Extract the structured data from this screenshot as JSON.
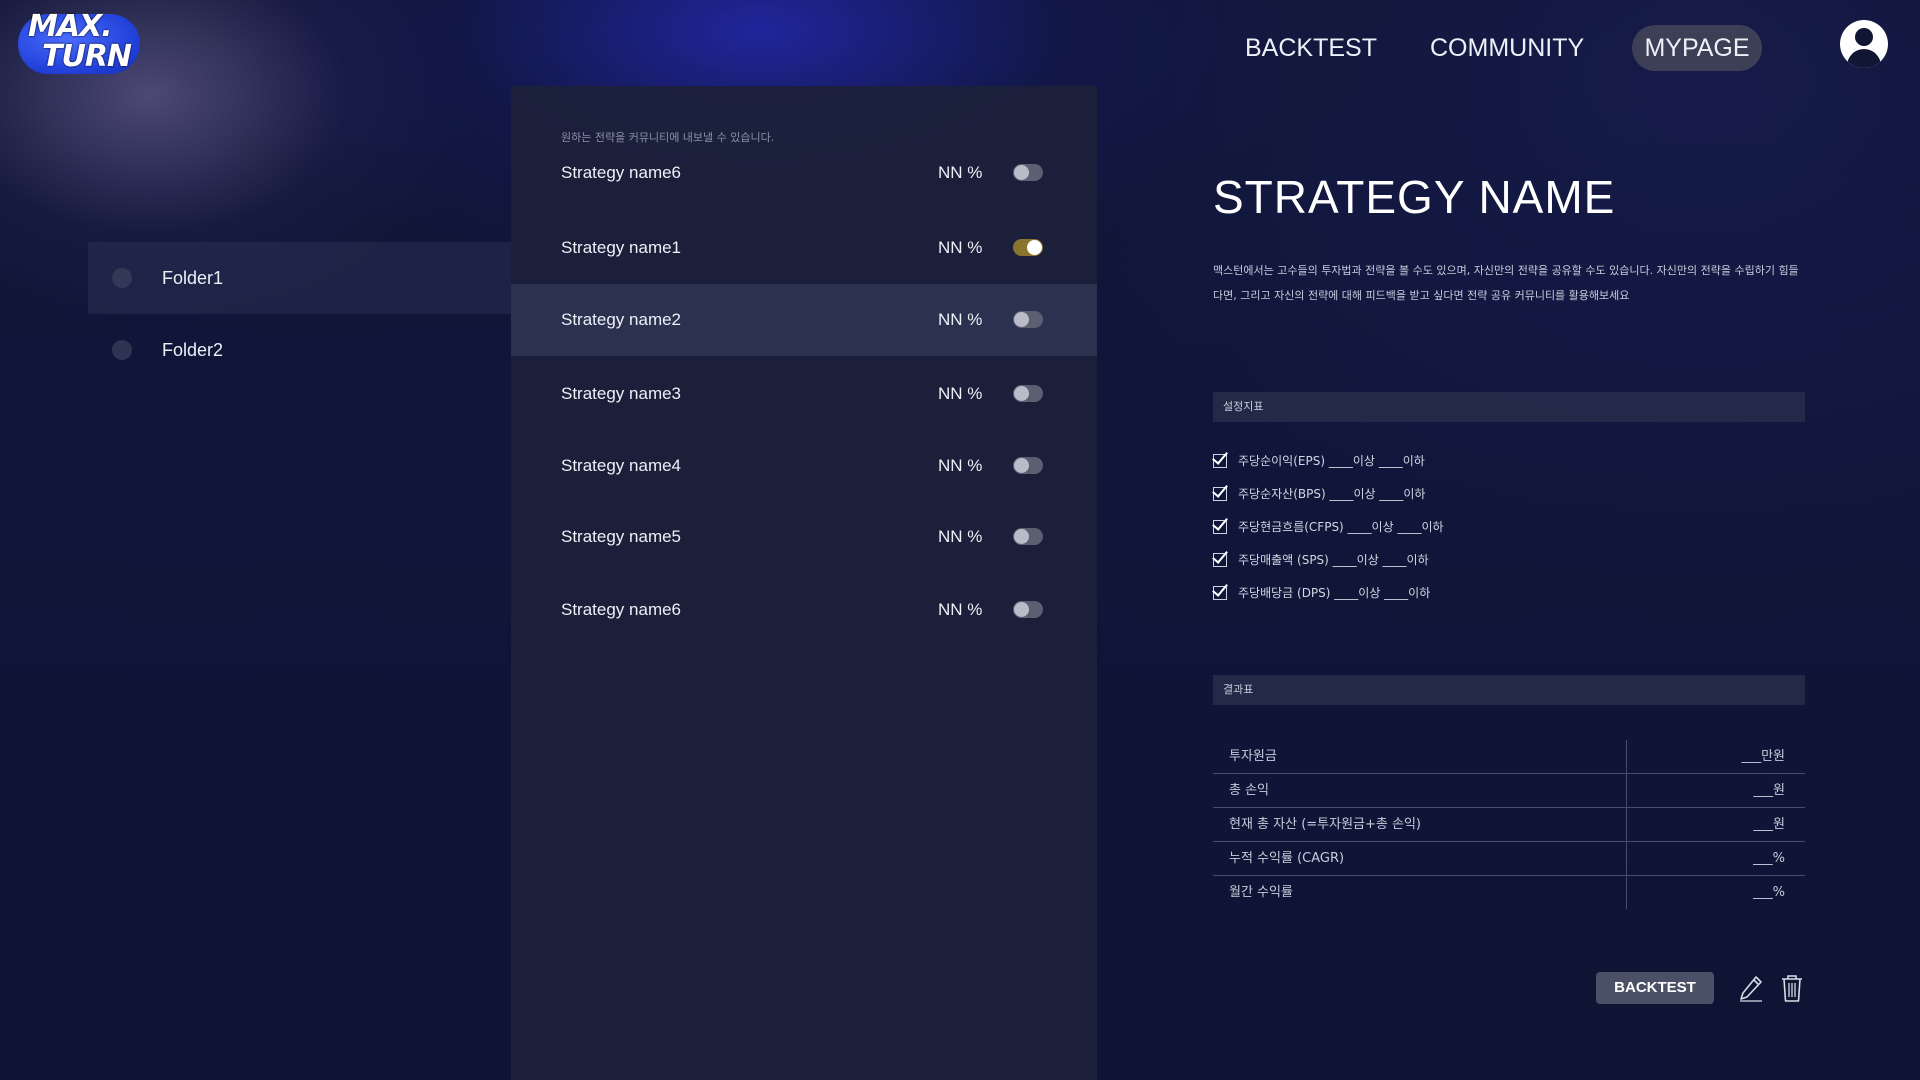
{
  "header": {
    "logo": {
      "line1": "MAX.",
      "line2": "TURN"
    },
    "nav": [
      {
        "label": "BACKTEST"
      },
      {
        "label": "COMMUNITY"
      },
      {
        "label": "MYPAGE",
        "active": true
      }
    ],
    "avatar_icon": "user-avatar-icon"
  },
  "folders": [
    {
      "label": "Folder1",
      "active": true
    },
    {
      "label": "Folder2",
      "active": false
    }
  ],
  "strategy_panel": {
    "hint": "원하는 전략을 커뮤니티에 내보낼 수 있습니다.",
    "items": [
      {
        "name": "Strategy name6",
        "pct": "NN %",
        "toggle_on": false
      },
      {
        "name": "Strategy name1",
        "pct": "NN %",
        "toggle_on": true
      },
      {
        "name": "Strategy name2",
        "pct": "NN %",
        "toggle_on": false,
        "selected": true
      },
      {
        "name": "Strategy name3",
        "pct": "NN %",
        "toggle_on": false
      },
      {
        "name": "Strategy name4",
        "pct": "NN %",
        "toggle_on": false
      },
      {
        "name": "Strategy name5",
        "pct": "NN %",
        "toggle_on": false
      },
      {
        "name": "Strategy name6",
        "pct": "NN %",
        "toggle_on": false
      }
    ]
  },
  "detail": {
    "title": "STRATEGY NAME",
    "description": "맥스턴에서는 고수들의 투자법과 전략을 볼 수도 있으며, 자신만의 전략을 공유할 수도 있습니다. 자신만의 전략을 수립하기 힘들다면, 그리고 자신의 전략에 대해 피드백을 받고 싶다면 전략 공유 커뮤니티를 활용해보세요",
    "criteria_label": "설정지표",
    "criteria": [
      {
        "text": "주당순이익(EPS) ____이상 ____이하",
        "checked": true
      },
      {
        "text": "주당순자산(BPS) ____이상 ____이하",
        "checked": true
      },
      {
        "text": "주당현금흐름(CFPS) ____이상 ____이하",
        "checked": true
      },
      {
        "text": "주당매출액 (SPS) ____이상 ____이하",
        "checked": true
      },
      {
        "text": "주당배당금 (DPS) ____이상 ____이하",
        "checked": true
      }
    ],
    "results_label": "결과표",
    "results": [
      {
        "label": "투자원금",
        "value": "___만원"
      },
      {
        "label": "총 손익",
        "value": "___원"
      },
      {
        "label": "현재 총 자산 (=투자원금+총 손익)",
        "value": "___원"
      },
      {
        "label": "누적 수익률 (CAGR)",
        "value": "___%"
      },
      {
        "label": "월간 수익률",
        "value": "___%"
      }
    ],
    "actions": {
      "backtest_label": "BACKTEST",
      "edit_icon": "pencil-icon",
      "delete_icon": "trash-icon"
    }
  },
  "colors": {
    "toggle_on": "#8a7530",
    "toggle_off": "#5a5f72",
    "logo_blue": "#1f3ed6"
  }
}
